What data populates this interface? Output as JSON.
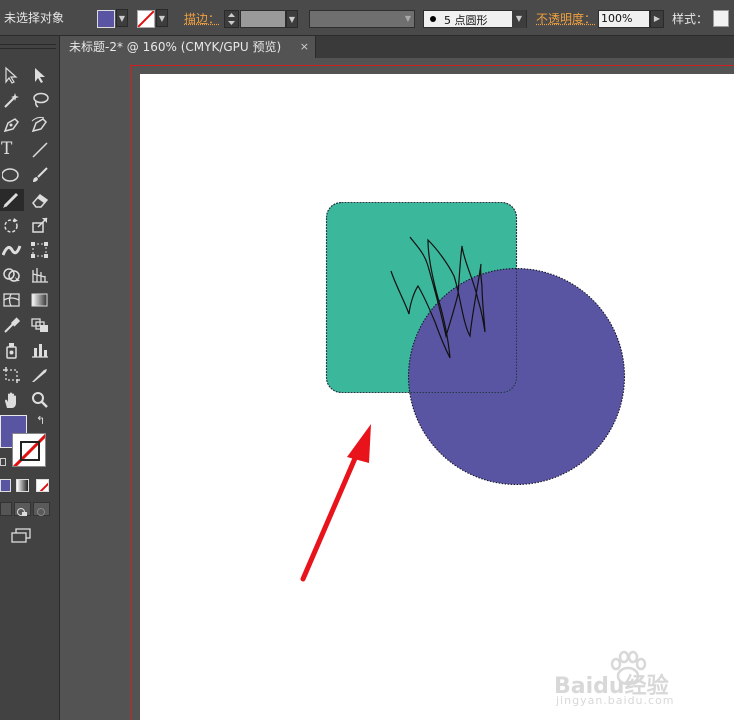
{
  "control_bar": {
    "selection_status": "未选择对象",
    "stroke_label": "描边：",
    "brush_profile": "5 点圆形",
    "opacity_label": "不透明度：",
    "opacity_value": "100%",
    "style_label": "样式："
  },
  "document_tab": {
    "title": "未标题-2* @ 160% (CMYK/GPU 预览)",
    "close_glyph": "×"
  },
  "tools": {
    "type_glyph": "T",
    "swap_glyph": "↰"
  },
  "colors": {
    "fill": "#5a55a2",
    "rect_fill": "#3bb79b",
    "circle_fill": "#5a55a2",
    "bleed_border": "#d02020",
    "arrow": "#e8131b"
  },
  "watermark": {
    "brand": "Baidu经验",
    "url": "jingyan.baidu.com"
  }
}
